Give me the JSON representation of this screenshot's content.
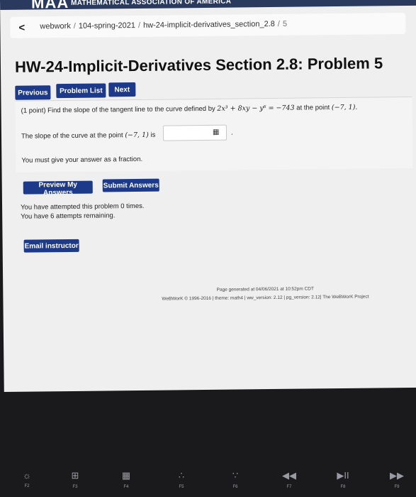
{
  "banner": {
    "logo": "MAA",
    "org": "MATHEMATICAL ASSOCIATION OF AMERICA"
  },
  "breadcrumb": {
    "back_symbol": "<",
    "items": [
      "webwork",
      "104-spring-2021",
      "hw-24-implicit-derivatives_section_2.8",
      "5"
    ],
    "separator": "/"
  },
  "page_title": "HW-24-Implicit-Derivatives Section 2.8: Problem 5",
  "nav_buttons": {
    "previous": "Previous",
    "problem_list": "Problem List",
    "next": "Next"
  },
  "problem": {
    "points": "(1 point)",
    "prompt_text": "Find the slope of the tangent line to the curve defined by",
    "equation": "2x³ + 8xy − y⁶ = −743",
    "at_point_text": "at the point",
    "point": "(−7, 1).",
    "answer_label": "The slope of the curve at the point",
    "answer_point": "(−7, 1)",
    "answer_label_suffix": "is",
    "answer_value": "",
    "matrix_icon": "▦",
    "answer_end": ".",
    "note": "You must give your answer as a fraction."
  },
  "action_buttons": {
    "preview": "Preview My Answers",
    "submit": "Submit Answers"
  },
  "attempts": {
    "line1": "You have attempted this problem 0 times.",
    "line2": "You have 6 attempts remaining."
  },
  "email_button": "Email instructor",
  "footer": {
    "generated": "Page generated at 04/06/2021 at 10:52pm CDT",
    "credits": "WeBWorK © 1996-2016 | theme: math4 | ww_version: 2.12 | pg_version: 2.12| The WeBWorK Project"
  },
  "keyboard": [
    {
      "glyph": "☼",
      "label": "F2"
    },
    {
      "glyph": "⊞",
      "label": "F3"
    },
    {
      "glyph": "▦",
      "label": "F4"
    },
    {
      "glyph": "∴",
      "label": "F5"
    },
    {
      "glyph": "∵",
      "label": "F6"
    },
    {
      "glyph": "◀◀",
      "label": "F7"
    },
    {
      "glyph": "▶II",
      "label": "F8"
    },
    {
      "glyph": "▶▶",
      "label": "F9"
    }
  ]
}
